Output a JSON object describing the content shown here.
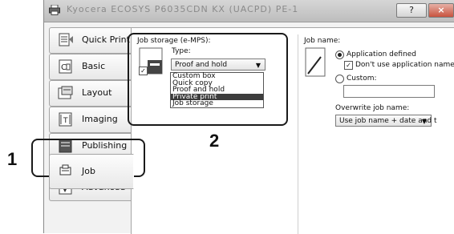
{
  "window": {
    "title": "Kyocera ECOSYS P6035CDN KX (UACPD) PE-1"
  },
  "titlebar_buttons": {
    "help": "?",
    "close": "×"
  },
  "tabs": [
    {
      "label": "Quick Print",
      "icon": "quick-print-icon"
    },
    {
      "label": "Basic",
      "icon": "basic-icon"
    },
    {
      "label": "Layout",
      "icon": "layout-icon"
    },
    {
      "label": "Imaging",
      "icon": "imaging-icon"
    },
    {
      "label": "Publishing",
      "icon": "publishing-icon"
    },
    {
      "label": "Job",
      "icon": "job-icon"
    },
    {
      "label": "Advanced",
      "icon": "advanced-icon"
    }
  ],
  "active_tab": "Job",
  "job_storage": {
    "heading": "Job storage (e-MPS):",
    "type_label": "Type:",
    "selected": "Proof and hold",
    "options": [
      "Custom box",
      "Quick copy",
      "Proof and hold",
      "Private print",
      "Job storage"
    ],
    "highlighted": "Private print",
    "enabled_checkbox": "✓"
  },
  "job_name": {
    "heading": "Job name:",
    "radio_app": "Application defined",
    "checkbox_dont_use": "Don't use application name",
    "radio_custom": "Custom:",
    "custom_value": "",
    "overwrite_label": "Overwrite job name:",
    "overwrite_value": "Use job name + date and t"
  },
  "callouts": {
    "one": "1",
    "two": "2"
  }
}
